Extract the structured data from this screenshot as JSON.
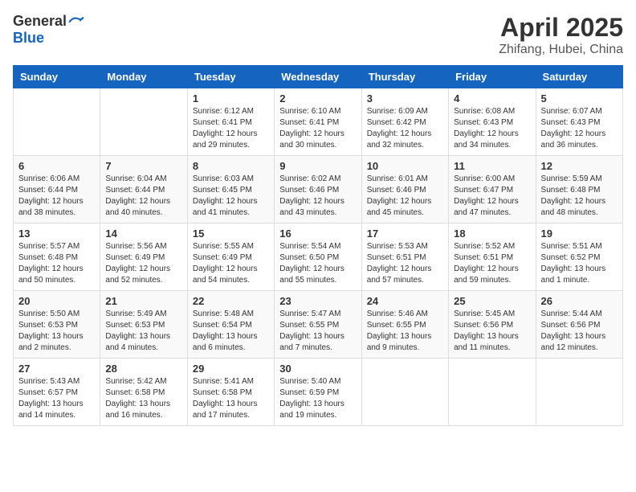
{
  "header": {
    "logo_general": "General",
    "logo_blue": "Blue",
    "month_title": "April 2025",
    "location": "Zhifang, Hubei, China"
  },
  "days_of_week": [
    "Sunday",
    "Monday",
    "Tuesday",
    "Wednesday",
    "Thursday",
    "Friday",
    "Saturday"
  ],
  "weeks": [
    [
      null,
      null,
      {
        "day": 1,
        "sunrise": "6:12 AM",
        "sunset": "6:41 PM",
        "daylight": "12 hours and 29 minutes."
      },
      {
        "day": 2,
        "sunrise": "6:10 AM",
        "sunset": "6:41 PM",
        "daylight": "12 hours and 30 minutes."
      },
      {
        "day": 3,
        "sunrise": "6:09 AM",
        "sunset": "6:42 PM",
        "daylight": "12 hours and 32 minutes."
      },
      {
        "day": 4,
        "sunrise": "6:08 AM",
        "sunset": "6:43 PM",
        "daylight": "12 hours and 34 minutes."
      },
      {
        "day": 5,
        "sunrise": "6:07 AM",
        "sunset": "6:43 PM",
        "daylight": "12 hours and 36 minutes."
      }
    ],
    [
      {
        "day": 6,
        "sunrise": "6:06 AM",
        "sunset": "6:44 PM",
        "daylight": "12 hours and 38 minutes."
      },
      {
        "day": 7,
        "sunrise": "6:04 AM",
        "sunset": "6:44 PM",
        "daylight": "12 hours and 40 minutes."
      },
      {
        "day": 8,
        "sunrise": "6:03 AM",
        "sunset": "6:45 PM",
        "daylight": "12 hours and 41 minutes."
      },
      {
        "day": 9,
        "sunrise": "6:02 AM",
        "sunset": "6:46 PM",
        "daylight": "12 hours and 43 minutes."
      },
      {
        "day": 10,
        "sunrise": "6:01 AM",
        "sunset": "6:46 PM",
        "daylight": "12 hours and 45 minutes."
      },
      {
        "day": 11,
        "sunrise": "6:00 AM",
        "sunset": "6:47 PM",
        "daylight": "12 hours and 47 minutes."
      },
      {
        "day": 12,
        "sunrise": "5:59 AM",
        "sunset": "6:48 PM",
        "daylight": "12 hours and 48 minutes."
      }
    ],
    [
      {
        "day": 13,
        "sunrise": "5:57 AM",
        "sunset": "6:48 PM",
        "daylight": "12 hours and 50 minutes."
      },
      {
        "day": 14,
        "sunrise": "5:56 AM",
        "sunset": "6:49 PM",
        "daylight": "12 hours and 52 minutes."
      },
      {
        "day": 15,
        "sunrise": "5:55 AM",
        "sunset": "6:49 PM",
        "daylight": "12 hours and 54 minutes."
      },
      {
        "day": 16,
        "sunrise": "5:54 AM",
        "sunset": "6:50 PM",
        "daylight": "12 hours and 55 minutes."
      },
      {
        "day": 17,
        "sunrise": "5:53 AM",
        "sunset": "6:51 PM",
        "daylight": "12 hours and 57 minutes."
      },
      {
        "day": 18,
        "sunrise": "5:52 AM",
        "sunset": "6:51 PM",
        "daylight": "12 hours and 59 minutes."
      },
      {
        "day": 19,
        "sunrise": "5:51 AM",
        "sunset": "6:52 PM",
        "daylight": "13 hours and 1 minute."
      }
    ],
    [
      {
        "day": 20,
        "sunrise": "5:50 AM",
        "sunset": "6:53 PM",
        "daylight": "13 hours and 2 minutes."
      },
      {
        "day": 21,
        "sunrise": "5:49 AM",
        "sunset": "6:53 PM",
        "daylight": "13 hours and 4 minutes."
      },
      {
        "day": 22,
        "sunrise": "5:48 AM",
        "sunset": "6:54 PM",
        "daylight": "13 hours and 6 minutes."
      },
      {
        "day": 23,
        "sunrise": "5:47 AM",
        "sunset": "6:55 PM",
        "daylight": "13 hours and 7 minutes."
      },
      {
        "day": 24,
        "sunrise": "5:46 AM",
        "sunset": "6:55 PM",
        "daylight": "13 hours and 9 minutes."
      },
      {
        "day": 25,
        "sunrise": "5:45 AM",
        "sunset": "6:56 PM",
        "daylight": "13 hours and 11 minutes."
      },
      {
        "day": 26,
        "sunrise": "5:44 AM",
        "sunset": "6:56 PM",
        "daylight": "13 hours and 12 minutes."
      }
    ],
    [
      {
        "day": 27,
        "sunrise": "5:43 AM",
        "sunset": "6:57 PM",
        "daylight": "13 hours and 14 minutes."
      },
      {
        "day": 28,
        "sunrise": "5:42 AM",
        "sunset": "6:58 PM",
        "daylight": "13 hours and 16 minutes."
      },
      {
        "day": 29,
        "sunrise": "5:41 AM",
        "sunset": "6:58 PM",
        "daylight": "13 hours and 17 minutes."
      },
      {
        "day": 30,
        "sunrise": "5:40 AM",
        "sunset": "6:59 PM",
        "daylight": "13 hours and 19 minutes."
      },
      null,
      null,
      null
    ]
  ]
}
